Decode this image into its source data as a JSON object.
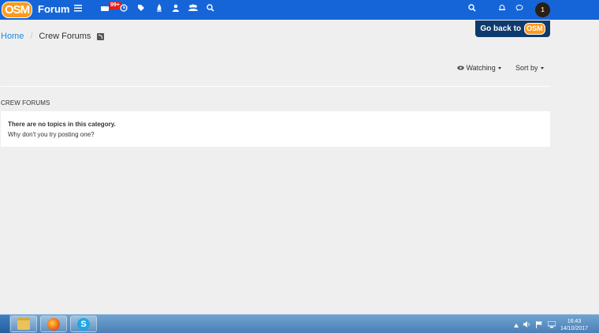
{
  "navbar": {
    "logo_text": "OSM",
    "brand": "Forum",
    "notification_badge": "99+",
    "avatar_text": "1"
  },
  "go_back": {
    "label": "Go back to",
    "logo_text": "OSM"
  },
  "breadcrumb": {
    "home": "Home",
    "separator": "/",
    "current": "Crew Forums"
  },
  "toolbar": {
    "watching": "Watching",
    "sort_by": "Sort by"
  },
  "section": {
    "title": "CREW FORUMS"
  },
  "empty_state": {
    "title": "There are no topics in this category.",
    "subtitle": "Why don't you try posting one?"
  },
  "taskbar": {
    "skype_letter": "S",
    "time": "16:43",
    "date": "14/10/2017"
  }
}
